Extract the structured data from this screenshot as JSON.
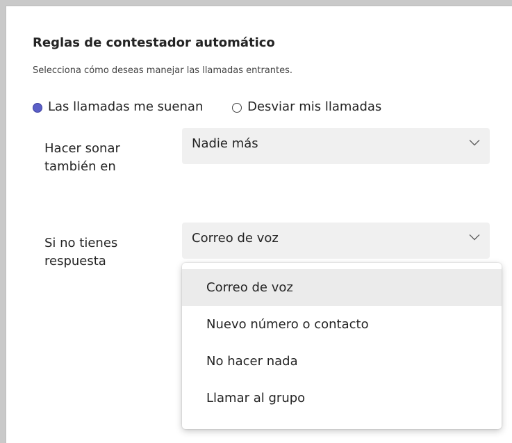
{
  "section": {
    "title": "Reglas de contestador automático",
    "subtitle": "Selecciona cómo deseas manejar las llamadas entrantes."
  },
  "call_mode": {
    "options": [
      {
        "label": "Las llamadas me suenan",
        "checked": true
      },
      {
        "label": "Desviar mis llamadas",
        "checked": false
      }
    ]
  },
  "ring_also": {
    "label": "Hacer sonar también en",
    "value": "Nadie más"
  },
  "no_answer": {
    "label": "Si no tienes respuesta",
    "value": "Correo de voz",
    "dropdown_open": true,
    "options": [
      {
        "label": "Correo de voz",
        "selected": true
      },
      {
        "label": "Nuevo número o contacto",
        "selected": false
      },
      {
        "label": "No hacer nada",
        "selected": false
      },
      {
        "label": "Llamar al grupo",
        "selected": false
      }
    ]
  },
  "colors": {
    "accent": "#5b5fc7",
    "select_bg": "#f0f0f0",
    "hover_bg": "#ebebeb"
  }
}
